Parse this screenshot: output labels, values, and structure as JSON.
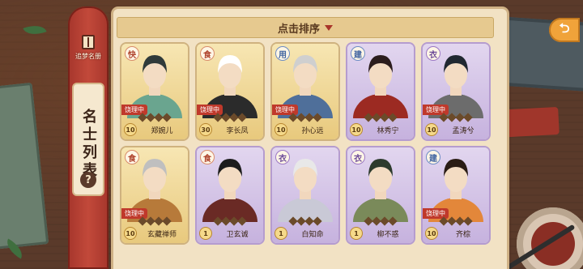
{
  "rail": {
    "book_label": "追梦名册",
    "title": "名士列表",
    "help_symbol": "?"
  },
  "sort_bar": {
    "label": "点击排序"
  },
  "status_label": "饶理中",
  "cards": [
    {
      "badge": "快",
      "level": "10",
      "name": "郑婉儿",
      "status": true,
      "frame": "gold",
      "badge_color": "red",
      "diamonds": 4
    },
    {
      "badge": "食",
      "level": "30",
      "name": "李长凤",
      "status": true,
      "frame": "gold",
      "badge_color": "red",
      "diamonds": 4
    },
    {
      "badge": "用",
      "level": "10",
      "name": "孙心远",
      "status": true,
      "frame": "gold",
      "badge_color": "blue",
      "diamonds": 4
    },
    {
      "badge": "建",
      "level": "10",
      "name": "林秀宁",
      "status": false,
      "frame": "purple",
      "badge_color": "blue",
      "diamonds": 4
    },
    {
      "badge": "衣",
      "level": "10",
      "name": "孟涛兮",
      "status": true,
      "frame": "purple",
      "badge_color": "purple",
      "diamonds": 4
    },
    {
      "badge": "食",
      "level": "10",
      "name": "玄藏禅师",
      "status": true,
      "frame": "gold",
      "badge_color": "red",
      "diamonds": 4
    },
    {
      "badge": "食",
      "level": "1",
      "name": "卫玄诚",
      "status": false,
      "frame": "purple",
      "badge_color": "red",
      "diamonds": 4
    },
    {
      "badge": "衣",
      "level": "1",
      "name": "白知命",
      "status": false,
      "frame": "purple",
      "badge_color": "purple",
      "diamonds": 4
    },
    {
      "badge": "衣",
      "level": "1",
      "name": "柳不惑",
      "status": false,
      "frame": "purple",
      "badge_color": "purple",
      "diamonds": 4
    },
    {
      "badge": "建",
      "level": "10",
      "name": "齐棕",
      "status": true,
      "frame": "purple",
      "badge_color": "blue",
      "diamonds": 4
    }
  ],
  "colors": {
    "rail": "#c2493a",
    "panel": "#f2e2c4",
    "status": "#c0392b",
    "back_button": "#f0a33a"
  }
}
